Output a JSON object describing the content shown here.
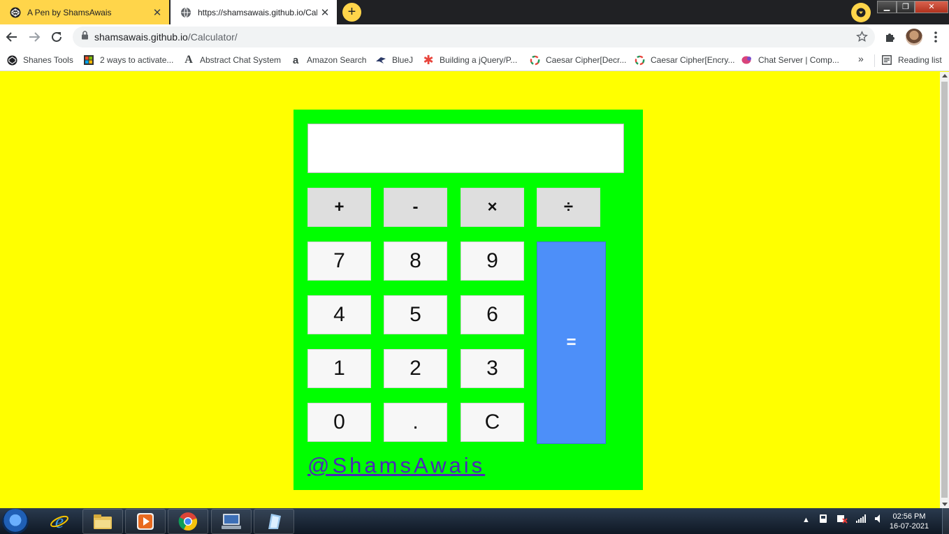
{
  "browser": {
    "tabs": [
      {
        "title": "A Pen by ShamsAwais",
        "icon": "codepen-icon",
        "active": false
      },
      {
        "title": "https://shamsawais.github.io/Calc",
        "icon": "globe-icon",
        "active": true
      }
    ],
    "new_tab_label": "+",
    "address": {
      "host": "shamsawais.github.io",
      "path": "/Calculator/"
    },
    "bookmarks": [
      {
        "label": "Shanes Tools",
        "icon": "codepen-icon"
      },
      {
        "label": "2 ways to activate...",
        "icon": "windows-icon"
      },
      {
        "label": "Abstract Chat System",
        "icon": "letter-a-icon"
      },
      {
        "label": "Amazon Search",
        "icon": "amazon-icon"
      },
      {
        "label": "BlueJ",
        "icon": "bluej-icon"
      },
      {
        "label": "Building a jQuery/P...",
        "icon": "asterisk-icon"
      },
      {
        "label": "Caesar Cipher[Decr...",
        "icon": "ring-icon"
      },
      {
        "label": "Caesar Cipher[Encry...",
        "icon": "ring-icon"
      },
      {
        "label": "Chat Server | Comp...",
        "icon": "chat-icon"
      }
    ],
    "bookmarks_overflow": "»",
    "reading_list": "Reading list"
  },
  "calculator": {
    "display_value": "",
    "operators": [
      "+",
      "-",
      "×",
      "÷"
    ],
    "rows": [
      [
        "7",
        "8",
        "9"
      ],
      [
        "4",
        "5",
        "6"
      ],
      [
        "1",
        "2",
        "3"
      ],
      [
        "0",
        ".",
        "C"
      ]
    ],
    "equals_label": "=",
    "credit": "@ShamsAwais"
  },
  "colors": {
    "page_background": "#ffff00",
    "calculator_background": "#00ff00",
    "equals_button": "#4d8ff9",
    "credit_link": "#4b28b8"
  },
  "taskbar": {
    "apps": [
      "file-explorer-icon",
      "media-player-icon",
      "chrome-icon",
      "remote-desktop-icon",
      "notepad-icon"
    ],
    "time": "02:56 PM",
    "date": "16-07-2021"
  }
}
